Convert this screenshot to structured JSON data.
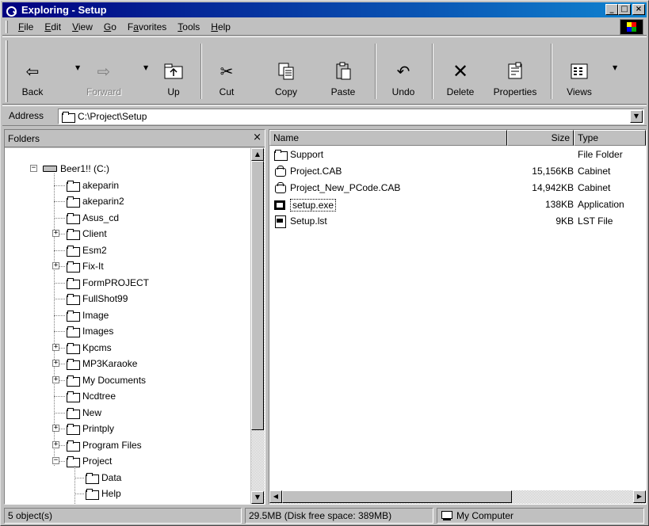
{
  "window": {
    "title": "Exploring - Setup",
    "controls": {
      "minimize": "_",
      "maximize": "□",
      "close": "×"
    }
  },
  "menu": [
    {
      "pre": "",
      "u": "F",
      "post": "ile"
    },
    {
      "pre": "",
      "u": "E",
      "post": "dit"
    },
    {
      "pre": "",
      "u": "V",
      "post": "iew"
    },
    {
      "pre": "",
      "u": "G",
      "post": "o"
    },
    {
      "pre": "F",
      "u": "a",
      "post": "vorites"
    },
    {
      "pre": "",
      "u": "T",
      "post": "ools"
    },
    {
      "pre": "",
      "u": "H",
      "post": "elp"
    }
  ],
  "toolbar": {
    "back": "Back",
    "forward": "Forward",
    "up": "Up",
    "cut": "Cut",
    "copy": "Copy",
    "paste": "Paste",
    "undo": "Undo",
    "delete": "Delete",
    "properties": "Properties",
    "views": "Views"
  },
  "address": {
    "label": "Address",
    "value": "C:\\Project\\Setup"
  },
  "folders": {
    "header": "Folders",
    "close": "×",
    "root": "Beer1!! (C:)",
    "items": [
      {
        "label": "akeparin",
        "expander": ""
      },
      {
        "label": "akeparin2",
        "expander": ""
      },
      {
        "label": "Asus_cd",
        "expander": ""
      },
      {
        "label": "Client",
        "expander": "+"
      },
      {
        "label": "Esm2",
        "expander": ""
      },
      {
        "label": "Fix-It",
        "expander": "+"
      },
      {
        "label": "FormPROJECT",
        "expander": ""
      },
      {
        "label": "FullShot99",
        "expander": ""
      },
      {
        "label": "Image",
        "expander": ""
      },
      {
        "label": "Images",
        "expander": ""
      },
      {
        "label": "Kpcms",
        "expander": "+"
      },
      {
        "label": "MP3Karaoke",
        "expander": "+"
      },
      {
        "label": "My Documents",
        "expander": "+"
      },
      {
        "label": "Ncdtree",
        "expander": ""
      },
      {
        "label": "New",
        "expander": ""
      },
      {
        "label": "Printply",
        "expander": "+"
      },
      {
        "label": "Program Files",
        "expander": "+"
      },
      {
        "label": "Project",
        "expander": "−"
      }
    ],
    "project_children": [
      "Data",
      "Help"
    ]
  },
  "files": {
    "columns": {
      "name": "Name",
      "size": "Size",
      "type": "Type"
    },
    "rows": [
      {
        "name": "Support",
        "size": "",
        "type": "File Folder",
        "icon": "folder-icon"
      },
      {
        "name": "Project.CAB",
        "size": "15,156KB",
        "type": "Cabinet",
        "icon": "cabinet-icon"
      },
      {
        "name": "Project_New_PCode.CAB",
        "size": "14,942KB",
        "type": "Cabinet",
        "icon": "cabinet-icon"
      },
      {
        "name": "setup.exe",
        "size": "138KB",
        "type": "Application",
        "icon": "application-icon"
      },
      {
        "name": "Setup.lst",
        "size": "9KB",
        "type": "LST File",
        "icon": "lst-file-icon"
      }
    ]
  },
  "status": {
    "objects": "5 object(s)",
    "disk": "29.5MB (Disk free space: 389MB)",
    "location": "My Computer"
  }
}
